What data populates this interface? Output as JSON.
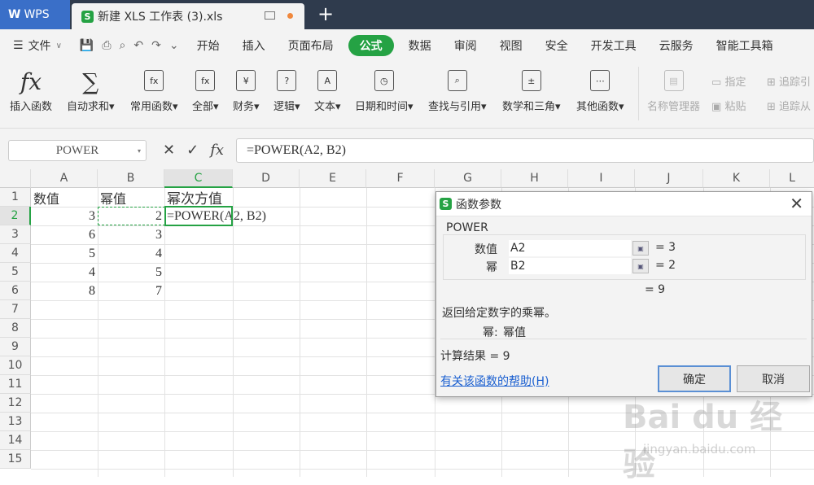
{
  "titlebar": {
    "app_name": "WPS",
    "file_tab": "新建 XLS 工作表 (3).xls"
  },
  "menu": [
    "文件",
    "开始",
    "插入",
    "页面布局",
    "公式",
    "数据",
    "审阅",
    "视图",
    "安全",
    "开发工具",
    "云服务",
    "智能工具箱"
  ],
  "ribbon": [
    {
      "label": "插入函数",
      "icon": "fx-icon"
    },
    {
      "label": "自动求和",
      "icon": "sigma-icon"
    },
    {
      "label": "常用函数",
      "icon": "star-function-icon"
    },
    {
      "label": "全部",
      "icon": "fx-box-icon"
    },
    {
      "label": "财务",
      "icon": "yen-icon"
    },
    {
      "label": "逻辑",
      "icon": "question-icon"
    },
    {
      "label": "文本",
      "icon": "text-icon"
    },
    {
      "label": "日期和时间",
      "icon": "clock-icon"
    },
    {
      "label": "查找与引用",
      "icon": "search-icon"
    },
    {
      "label": "数学和三角",
      "icon": "math-icon"
    },
    {
      "label": "其他函数",
      "icon": "more-icon"
    },
    {
      "label": "名称管理器",
      "icon": "name-manager-icon"
    },
    {
      "label": "指定",
      "icon": "assign-icon"
    },
    {
      "label": "粘贴",
      "icon": "paste-icon"
    },
    {
      "label": "追踪引",
      "icon": "trace-precedents-icon"
    },
    {
      "label": "追踪从",
      "icon": "trace-dependents-icon"
    }
  ],
  "formula_bar": {
    "name_box": "POWER",
    "formula": "=POWER(A2, B2)",
    "fx": "fx"
  },
  "columns": [
    "A",
    "B",
    "C",
    "D",
    "E",
    "F",
    "G",
    "H",
    "I",
    "J",
    "K",
    "L"
  ],
  "rows": [
    "1",
    "2",
    "3",
    "4",
    "5",
    "6",
    "7",
    "8",
    "9",
    "10",
    "11",
    "12",
    "13",
    "14",
    "15"
  ],
  "cells": {
    "A1": "数值",
    "B1": "幂值",
    "C1": "幂次方值",
    "A2": "3",
    "B2": "2",
    "C2": "=POWER(A2, B2)",
    "A3": "6",
    "B3": "3",
    "A4": "5",
    "B4": "4",
    "A5": "4",
    "B5": "5",
    "A6": "8",
    "B6": "7"
  },
  "dialog": {
    "title": "函数参数",
    "function_name": "POWER",
    "param1_label": "数值",
    "param1_value": "A2",
    "param1_result": "= 3",
    "param2_label": "幂",
    "param2_value": "B2",
    "param2_result": "= 2",
    "overall_result": "= 9",
    "description": "返回给定数字的乘幂。",
    "param_desc_label": "幂:",
    "param_desc_text": "幂值",
    "calc_result": "计算结果 = 9",
    "help_link": "有关该函数的帮助(H)",
    "ok": "确定",
    "cancel": "取消"
  },
  "watermark": {
    "brand": "Bai du 经验",
    "url": "jingyan.baidu.com"
  }
}
